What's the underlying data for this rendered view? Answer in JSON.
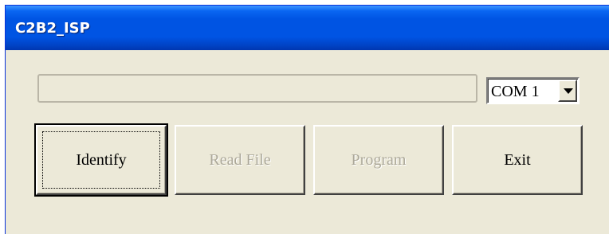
{
  "window": {
    "title": "C2B2_ISP"
  },
  "progress": {
    "value_percent": 0
  },
  "com_port": {
    "selected": "COM 1"
  },
  "buttons": {
    "identify": "Identify",
    "read_file": "Read File",
    "program": "Program",
    "exit": "Exit"
  },
  "colors": {
    "titlebar": "#0054e3",
    "face": "#ece9d8",
    "disabled_text": "#aca899"
  }
}
